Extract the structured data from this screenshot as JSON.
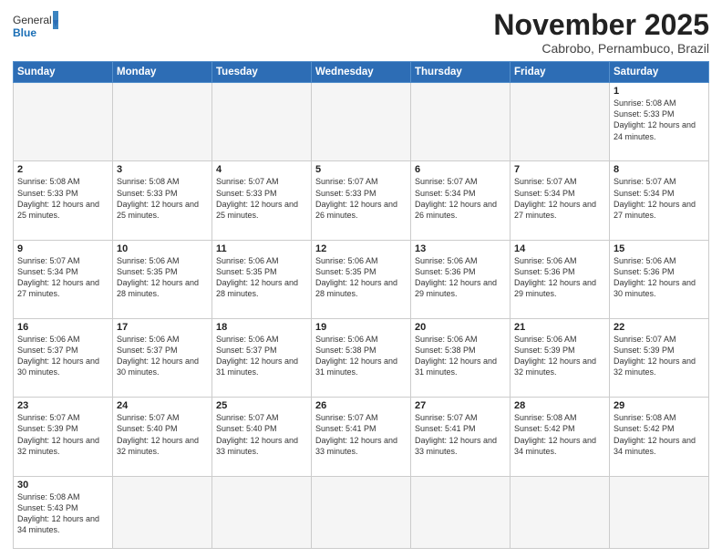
{
  "logo": {
    "text_general": "General",
    "text_blue": "Blue"
  },
  "header": {
    "month": "November 2025",
    "location": "Cabrobo, Pernambuco, Brazil"
  },
  "weekdays": [
    "Sunday",
    "Monday",
    "Tuesday",
    "Wednesday",
    "Thursday",
    "Friday",
    "Saturday"
  ],
  "weeks": [
    [
      {
        "day": "",
        "info": ""
      },
      {
        "day": "",
        "info": ""
      },
      {
        "day": "",
        "info": ""
      },
      {
        "day": "",
        "info": ""
      },
      {
        "day": "",
        "info": ""
      },
      {
        "day": "",
        "info": ""
      },
      {
        "day": "1",
        "info": "Sunrise: 5:08 AM\nSunset: 5:33 PM\nDaylight: 12 hours and 24 minutes."
      }
    ],
    [
      {
        "day": "2",
        "info": "Sunrise: 5:08 AM\nSunset: 5:33 PM\nDaylight: 12 hours and 25 minutes."
      },
      {
        "day": "3",
        "info": "Sunrise: 5:08 AM\nSunset: 5:33 PM\nDaylight: 12 hours and 25 minutes."
      },
      {
        "day": "4",
        "info": "Sunrise: 5:07 AM\nSunset: 5:33 PM\nDaylight: 12 hours and 25 minutes."
      },
      {
        "day": "5",
        "info": "Sunrise: 5:07 AM\nSunset: 5:33 PM\nDaylight: 12 hours and 26 minutes."
      },
      {
        "day": "6",
        "info": "Sunrise: 5:07 AM\nSunset: 5:34 PM\nDaylight: 12 hours and 26 minutes."
      },
      {
        "day": "7",
        "info": "Sunrise: 5:07 AM\nSunset: 5:34 PM\nDaylight: 12 hours and 27 minutes."
      },
      {
        "day": "8",
        "info": "Sunrise: 5:07 AM\nSunset: 5:34 PM\nDaylight: 12 hours and 27 minutes."
      }
    ],
    [
      {
        "day": "9",
        "info": "Sunrise: 5:07 AM\nSunset: 5:34 PM\nDaylight: 12 hours and 27 minutes."
      },
      {
        "day": "10",
        "info": "Sunrise: 5:06 AM\nSunset: 5:35 PM\nDaylight: 12 hours and 28 minutes."
      },
      {
        "day": "11",
        "info": "Sunrise: 5:06 AM\nSunset: 5:35 PM\nDaylight: 12 hours and 28 minutes."
      },
      {
        "day": "12",
        "info": "Sunrise: 5:06 AM\nSunset: 5:35 PM\nDaylight: 12 hours and 28 minutes."
      },
      {
        "day": "13",
        "info": "Sunrise: 5:06 AM\nSunset: 5:36 PM\nDaylight: 12 hours and 29 minutes."
      },
      {
        "day": "14",
        "info": "Sunrise: 5:06 AM\nSunset: 5:36 PM\nDaylight: 12 hours and 29 minutes."
      },
      {
        "day": "15",
        "info": "Sunrise: 5:06 AM\nSunset: 5:36 PM\nDaylight: 12 hours and 30 minutes."
      }
    ],
    [
      {
        "day": "16",
        "info": "Sunrise: 5:06 AM\nSunset: 5:37 PM\nDaylight: 12 hours and 30 minutes."
      },
      {
        "day": "17",
        "info": "Sunrise: 5:06 AM\nSunset: 5:37 PM\nDaylight: 12 hours and 30 minutes."
      },
      {
        "day": "18",
        "info": "Sunrise: 5:06 AM\nSunset: 5:37 PM\nDaylight: 12 hours and 31 minutes."
      },
      {
        "day": "19",
        "info": "Sunrise: 5:06 AM\nSunset: 5:38 PM\nDaylight: 12 hours and 31 minutes."
      },
      {
        "day": "20",
        "info": "Sunrise: 5:06 AM\nSunset: 5:38 PM\nDaylight: 12 hours and 31 minutes."
      },
      {
        "day": "21",
        "info": "Sunrise: 5:06 AM\nSunset: 5:39 PM\nDaylight: 12 hours and 32 minutes."
      },
      {
        "day": "22",
        "info": "Sunrise: 5:07 AM\nSunset: 5:39 PM\nDaylight: 12 hours and 32 minutes."
      }
    ],
    [
      {
        "day": "23",
        "info": "Sunrise: 5:07 AM\nSunset: 5:39 PM\nDaylight: 12 hours and 32 minutes."
      },
      {
        "day": "24",
        "info": "Sunrise: 5:07 AM\nSunset: 5:40 PM\nDaylight: 12 hours and 32 minutes."
      },
      {
        "day": "25",
        "info": "Sunrise: 5:07 AM\nSunset: 5:40 PM\nDaylight: 12 hours and 33 minutes."
      },
      {
        "day": "26",
        "info": "Sunrise: 5:07 AM\nSunset: 5:41 PM\nDaylight: 12 hours and 33 minutes."
      },
      {
        "day": "27",
        "info": "Sunrise: 5:07 AM\nSunset: 5:41 PM\nDaylight: 12 hours and 33 minutes."
      },
      {
        "day": "28",
        "info": "Sunrise: 5:08 AM\nSunset: 5:42 PM\nDaylight: 12 hours and 34 minutes."
      },
      {
        "day": "29",
        "info": "Sunrise: 5:08 AM\nSunset: 5:42 PM\nDaylight: 12 hours and 34 minutes."
      }
    ],
    [
      {
        "day": "30",
        "info": "Sunrise: 5:08 AM\nSunset: 5:43 PM\nDaylight: 12 hours and 34 minutes."
      },
      {
        "day": "",
        "info": ""
      },
      {
        "day": "",
        "info": ""
      },
      {
        "day": "",
        "info": ""
      },
      {
        "day": "",
        "info": ""
      },
      {
        "day": "",
        "info": ""
      },
      {
        "day": "",
        "info": ""
      }
    ]
  ]
}
